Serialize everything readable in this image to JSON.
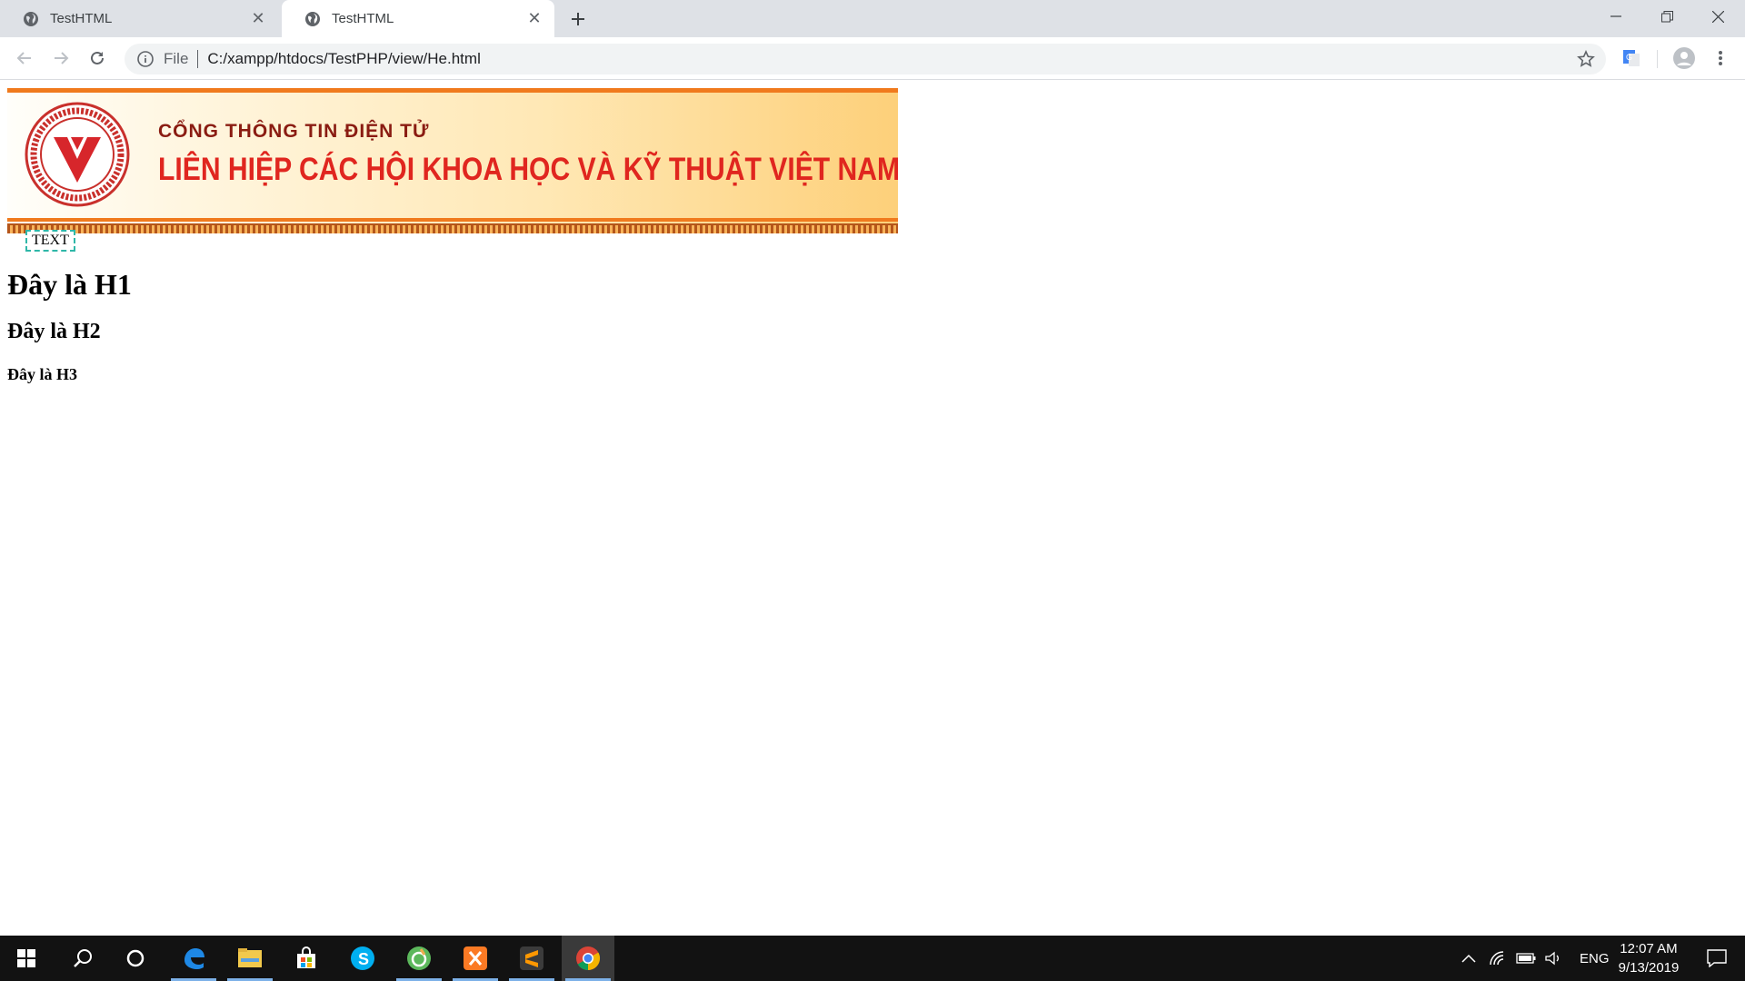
{
  "browser": {
    "tabs": [
      {
        "title": "TestHTML",
        "active": false
      },
      {
        "title": "TestHTML",
        "active": true
      }
    ],
    "new_tab_icon": "plus-icon",
    "address": {
      "scheme_label": "File",
      "url": "C:/xampp/htdocs/TestPHP/view/He.html"
    }
  },
  "page": {
    "banner": {
      "subtitle": "CỔNG THÔNG TIN ĐIỆN TỬ",
      "title": "LIÊN HIỆP CÁC HỘI KHOA HỌC VÀ KỸ THUẬT VIỆT NAM",
      "logo_text": "LIÊN HIỆP CÁC HỘI KHOA HỌC VÀ KỸ THUẬT VIỆT NAM - VUSTA",
      "colors": {
        "border": "#f07a1d",
        "title": "#e0261f",
        "subtitle": "#8a1c12"
      }
    },
    "text_box": "TEXT",
    "h1": "Đây là H1",
    "h2": "Đây là H2",
    "h3": "Đây là H3"
  },
  "taskbar": {
    "apps": [
      "start-icon",
      "search-icon",
      "cortana-icon",
      "edge-icon",
      "file-explorer-icon",
      "store-icon",
      "skype-icon",
      "app-icon",
      "xampp-icon",
      "sublime-text-icon",
      "chrome-icon"
    ],
    "language": "ENG",
    "time": "12:07 AM",
    "date": "9/13/2019"
  }
}
